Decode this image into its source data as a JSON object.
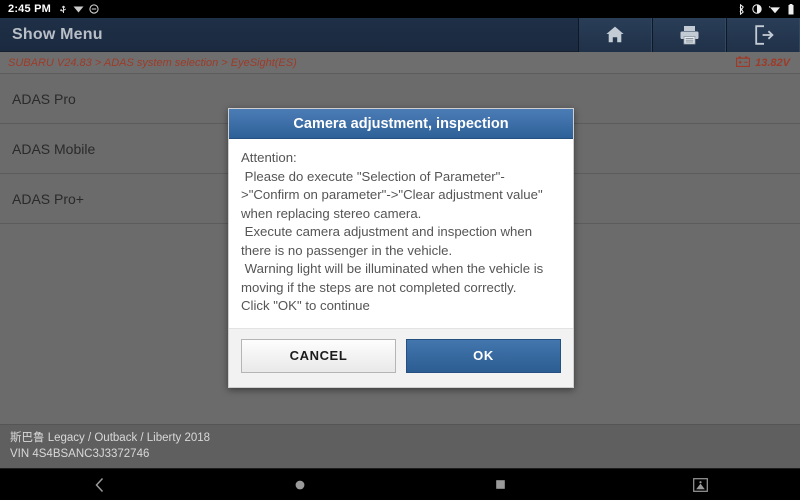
{
  "statusbar": {
    "time": "2:45 PM",
    "left_icons": [
      "usb-icon",
      "cast-icon",
      "do-not-disturb-icon"
    ],
    "right_icons": [
      "bluetooth-icon",
      "brightness-icon",
      "wifi-icon",
      "battery-icon"
    ]
  },
  "titlebar": {
    "title": "Show Menu",
    "buttons": [
      {
        "name": "home-button",
        "icon": "home-icon"
      },
      {
        "name": "print-button",
        "icon": "printer-icon"
      },
      {
        "name": "exit-button",
        "icon": "exit-icon"
      }
    ]
  },
  "breadcrumb": {
    "path": "SUBARU V24.83 > ADAS system selection > EyeSight(ES)",
    "battery_icon": "car-battery-icon",
    "voltage": "13.82V",
    "accent_color": "#9e3b28"
  },
  "list": {
    "items": [
      {
        "label": "ADAS Pro"
      },
      {
        "label": "ADAS Mobile"
      },
      {
        "label": "ADAS Pro+"
      }
    ]
  },
  "dialog": {
    "title": "Camera adjustment, inspection",
    "body": "Attention:\n Please do execute \"Selection of Parameter\"->\"Confirm on parameter\"->\"Clear adjustment value\" when replacing stereo camera.\n Execute camera adjustment and inspection when there is no passenger in the vehicle.\n Warning light will be illuminated when the vehicle is moving if the steps are not completed correctly.\nClick \"OK\" to continue",
    "cancel_label": "CANCEL",
    "ok_label": "OK",
    "header_color": "#2f6199",
    "ok_color": "#2c5d92"
  },
  "footer": {
    "vehicle": "斯巴鲁 Legacy / Outback / Liberty 2018",
    "vin": "VIN 4S4BSANC3J3372746"
  },
  "navbar": {
    "buttons": [
      {
        "name": "nav-back-button",
        "icon": "chevron-left-icon"
      },
      {
        "name": "nav-home-button",
        "icon": "circle-icon"
      },
      {
        "name": "nav-recents-button",
        "icon": "square-icon"
      },
      {
        "name": "nav-screenshot-button",
        "icon": "screenshot-icon"
      }
    ]
  }
}
